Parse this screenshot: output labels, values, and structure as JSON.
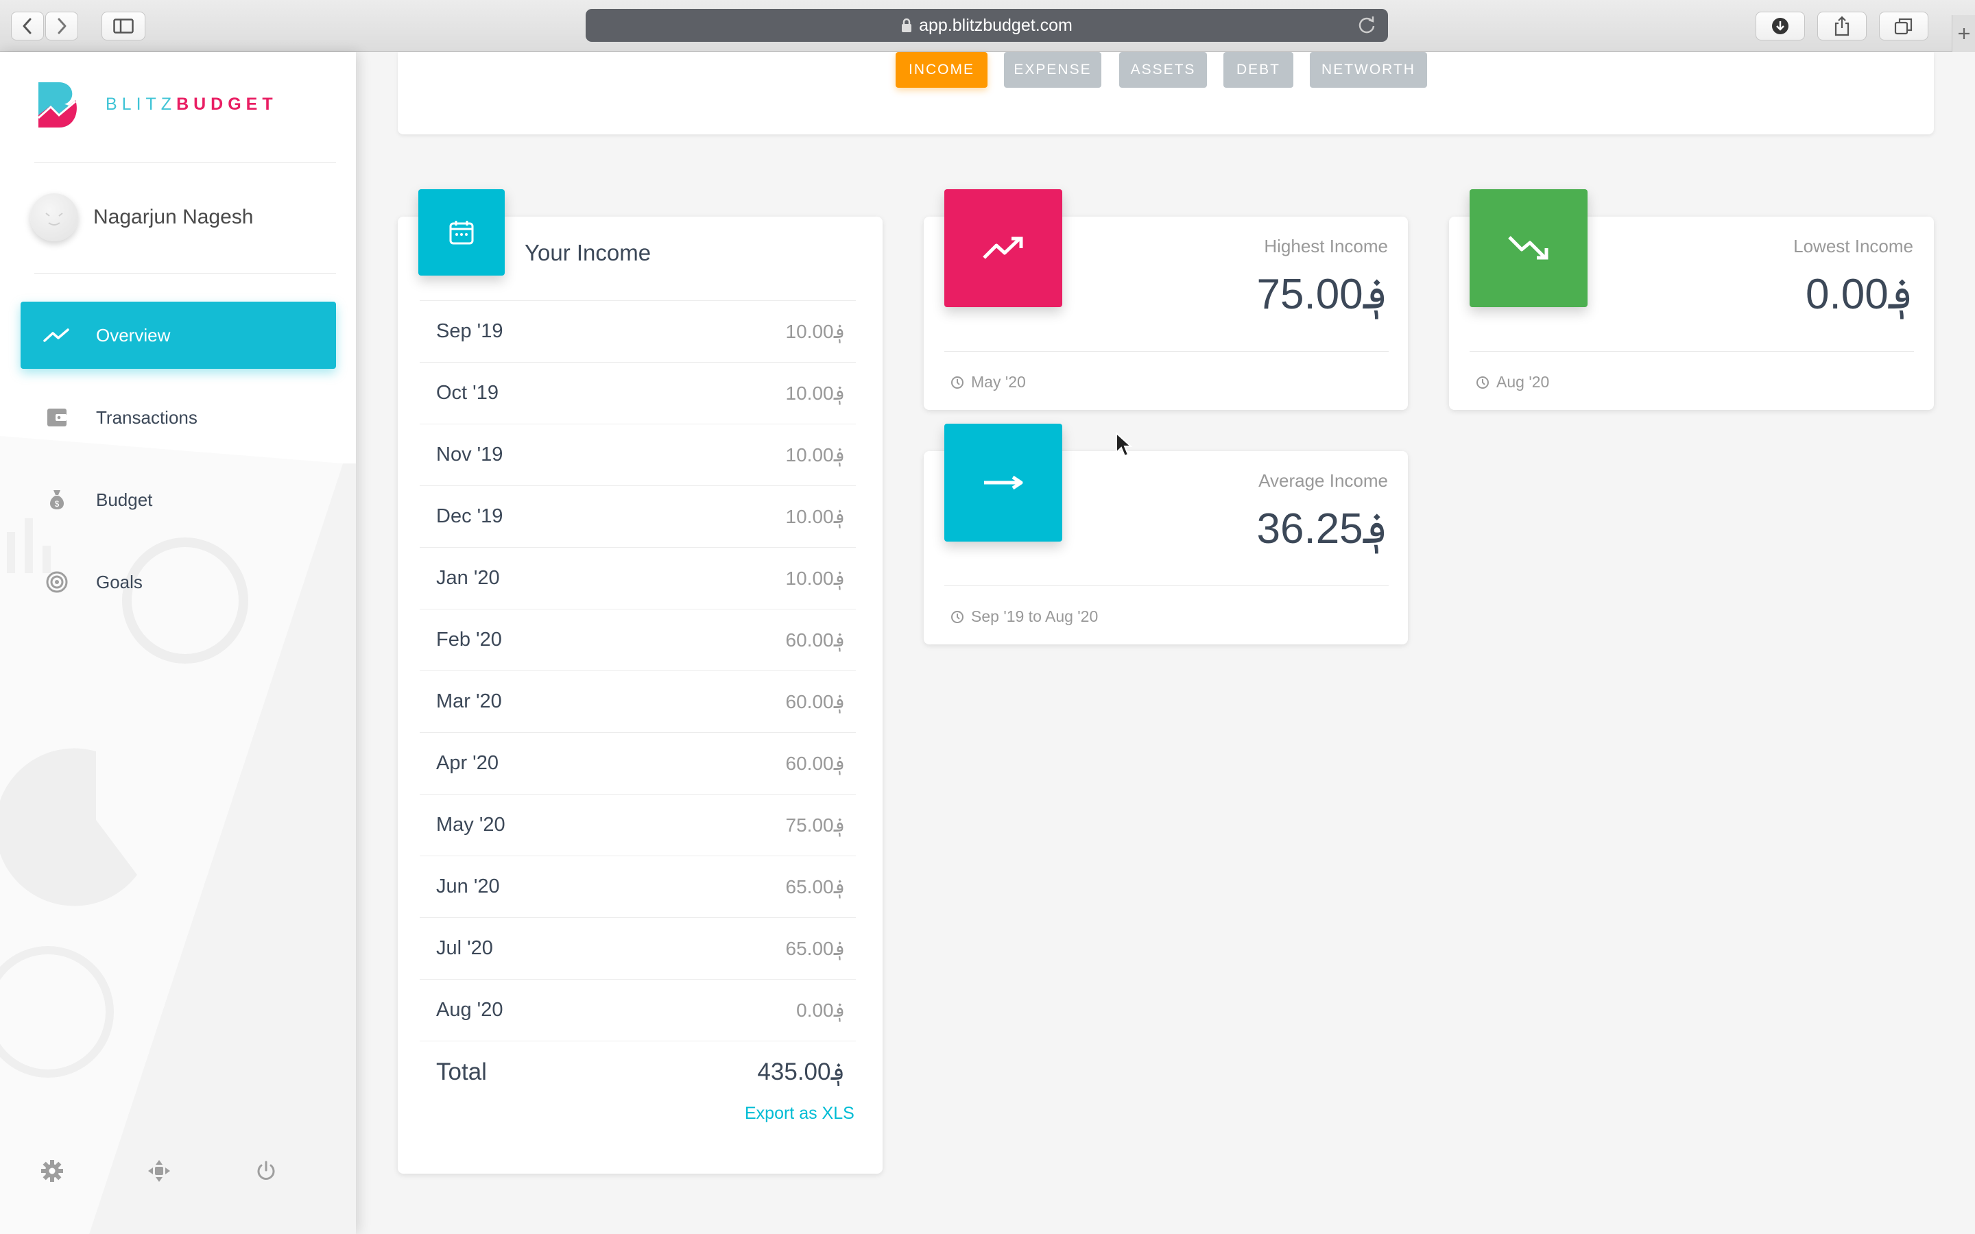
{
  "browser": {
    "url": "app.blitzbudget.com"
  },
  "sidebar": {
    "logo": {
      "part1": "BLITZ",
      "part2": "BUDGET"
    },
    "user_name": "Nagarjun Nagesh",
    "items": [
      {
        "label": "Overview",
        "icon": "trending-up-icon",
        "active": true
      },
      {
        "label": "Transactions",
        "icon": "wallet-icon",
        "active": false
      },
      {
        "label": "Budget",
        "icon": "money-bag-icon",
        "active": false
      },
      {
        "label": "Goals",
        "icon": "target-icon",
        "active": false
      }
    ],
    "bottom_icons": [
      "gear-icon",
      "move-icon",
      "power-icon"
    ]
  },
  "tabs": [
    {
      "label": "INCOME",
      "active": true
    },
    {
      "label": "EXPENSE",
      "active": false
    },
    {
      "label": "ASSETS",
      "active": false
    },
    {
      "label": "DEBT",
      "active": false
    },
    {
      "label": "NETWORTH",
      "active": false
    }
  ],
  "income_table": {
    "title": "Your Income",
    "rows": [
      {
        "month": "Sep '19",
        "amount": "10.00؋"
      },
      {
        "month": "Oct '19",
        "amount": "10.00؋"
      },
      {
        "month": "Nov '19",
        "amount": "10.00؋"
      },
      {
        "month": "Dec '19",
        "amount": "10.00؋"
      },
      {
        "month": "Jan '20",
        "amount": "10.00؋"
      },
      {
        "month": "Feb '20",
        "amount": "60.00؋"
      },
      {
        "month": "Mar '20",
        "amount": "60.00؋"
      },
      {
        "month": "Apr '20",
        "amount": "60.00؋"
      },
      {
        "month": "May '20",
        "amount": "75.00؋"
      },
      {
        "month": "Jun '20",
        "amount": "65.00؋"
      },
      {
        "month": "Jul '20",
        "amount": "65.00؋"
      },
      {
        "month": "Aug '20",
        "amount": "0.00؋"
      }
    ],
    "total_label": "Total",
    "total_value": "435.00؋",
    "export_label": "Export as XLS"
  },
  "stats": {
    "highest": {
      "label": "Highest Income",
      "value": "75.00؋",
      "footer": "May '20",
      "color": "#e91e63"
    },
    "lowest": {
      "label": "Lowest Income",
      "value": "0.00؋",
      "footer": "Aug '20",
      "color": "#4caf50"
    },
    "average": {
      "label": "Average Income",
      "value": "36.25؋",
      "footer": "Sep '19 to Aug '20",
      "color": "#00bcd4"
    }
  }
}
